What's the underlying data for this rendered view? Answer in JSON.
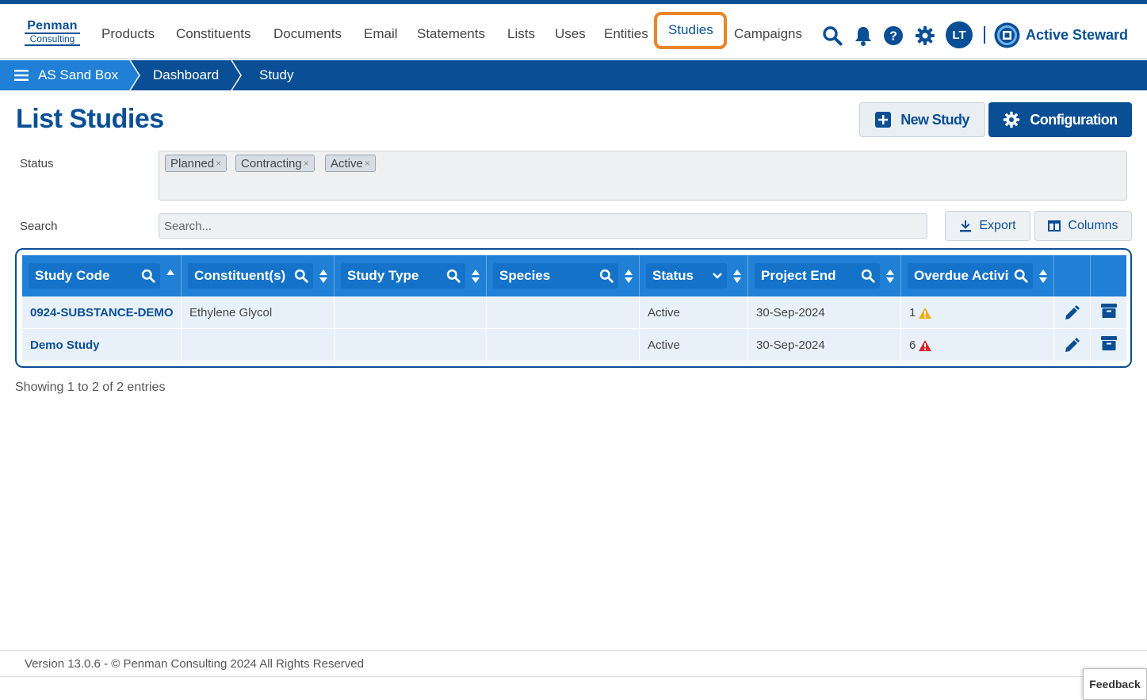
{
  "logo": {
    "line1": "Penman",
    "line2": "Consulting"
  },
  "nav": {
    "items": [
      "Products",
      "Constituents",
      "Documents",
      "Email",
      "Statements",
      "Lists",
      "Uses",
      "Entities",
      "Studies",
      "Campaigns"
    ],
    "active": "Studies"
  },
  "user": {
    "initials": "LT"
  },
  "brand": {
    "name": "Active Steward"
  },
  "breadcrumb": {
    "home": "AS Sand Box",
    "items": [
      "Dashboard",
      "Study"
    ]
  },
  "page": {
    "title": "List Studies"
  },
  "buttons": {
    "new_study": "New Study",
    "configuration": "Configuration",
    "export": "Export",
    "columns": "Columns"
  },
  "filters": {
    "status_label": "Status",
    "status_tags": [
      "Planned",
      "Contracting",
      "Active"
    ],
    "search_label": "Search",
    "search_placeholder": "Search..."
  },
  "table": {
    "columns": [
      "Study Code",
      "Constituent(s)",
      "Study Type",
      "Species",
      "Status",
      "Project End",
      "Overdue Activities"
    ],
    "rows": [
      {
        "code": "0924-SUBSTANCE-DEMO",
        "constituents": "Ethylene Glycol",
        "study_type": "",
        "species": "",
        "status": "Active",
        "project_end": "30-Sep-2024",
        "overdue": "1",
        "overdue_level": "warning"
      },
      {
        "code": "Demo Study",
        "constituents": "",
        "study_type": "",
        "species": "",
        "status": "Active",
        "project_end": "30-Sep-2024",
        "overdue": "6",
        "overdue_level": "danger"
      }
    ]
  },
  "info": {
    "showing": "Showing 1 to 2 of 2 entries"
  },
  "footer": {
    "version": "Version 13.0.6 - © Penman Consulting 2024 All Rights Reserved"
  },
  "feedback": {
    "label": "Feedback"
  },
  "colors": {
    "primary": "#0a4f95",
    "header_blue": "#1f80d6",
    "highlight": "#e8852a",
    "warning": "#f0ad1c",
    "danger": "#d9232d"
  }
}
